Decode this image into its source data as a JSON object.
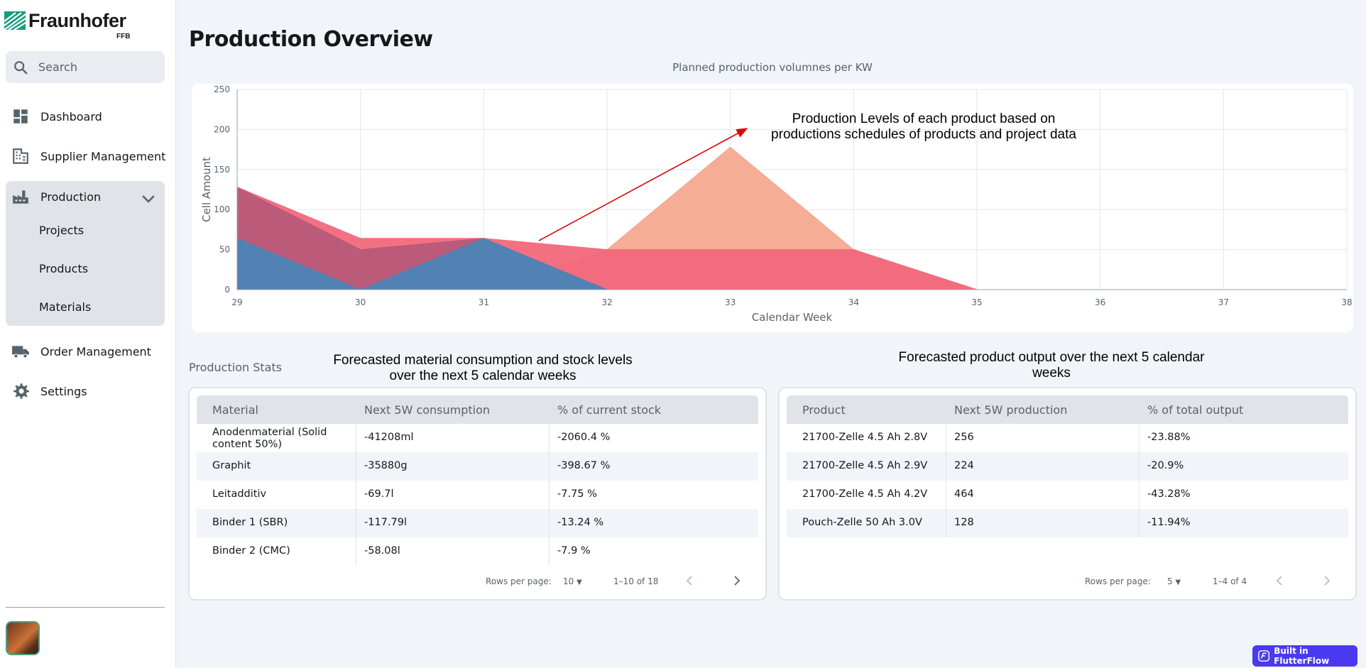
{
  "brand": {
    "name": "Fraunhofer",
    "sub": "FFB"
  },
  "search": {
    "placeholder": "Search"
  },
  "nav": {
    "dashboard": "Dashboard",
    "supplier": "Supplier Management",
    "production": "Production",
    "projects": "Projects",
    "products": "Products",
    "materials": "Materials",
    "order": "Order Management",
    "settings": "Settings"
  },
  "page": {
    "title": "Production Overview"
  },
  "chart_data": {
    "type": "area",
    "title": "Planned production volumnes per KW",
    "xlabel": "Calendar Week",
    "ylabel": "Cell Amount",
    "x": [
      29,
      30,
      31,
      32,
      33,
      34,
      35,
      36,
      37,
      38
    ],
    "ylim": [
      0,
      250
    ],
    "yticks": [
      0,
      50,
      100,
      150,
      200,
      250
    ],
    "grid": true,
    "series": [
      {
        "color": "#f4a98f",
        "values": [
          0,
          0,
          0,
          50,
          178,
          50,
          0,
          0,
          0,
          0
        ]
      },
      {
        "color": "#f2687c",
        "values": [
          128,
          64,
          64,
          50,
          50,
          50,
          0,
          0,
          0,
          0
        ]
      },
      {
        "color": "#b85a78",
        "values": [
          128,
          50,
          64,
          0,
          0,
          0,
          0,
          0,
          0,
          0
        ]
      },
      {
        "color": "#4c84b6",
        "values": [
          64,
          0,
          64,
          0,
          0,
          0,
          0,
          0,
          0,
          0
        ]
      }
    ]
  },
  "annotations": {
    "chart": "Production Levels of each product based on productions schedules of products and project data",
    "materials": "Forecasted material consumption and stock levels over the next 5 calendar weeks",
    "products": "Forecasted product output over the next 5 calendar weeks"
  },
  "stats": {
    "label": "Production Stats"
  },
  "materials_table": {
    "headers": [
      "Material",
      "Next 5W consumption",
      "% of current stock"
    ],
    "rows": [
      [
        "Anodenmaterial (Solid content 50%)",
        "-41208ml",
        "-2060.4 %"
      ],
      [
        "Graphit",
        "-35880g",
        "-398.67 %"
      ],
      [
        "Leitadditiv",
        "-69.7l",
        "-7.75 %"
      ],
      [
        "Binder 1 (SBR)",
        "-117.79l",
        "-13.24 %"
      ],
      [
        "Binder 2 (CMC)",
        "-58.08l",
        "-7.9 %"
      ]
    ],
    "footer": {
      "rows_label": "Rows per page:",
      "rows_value": "10",
      "range": "1–10 of 18"
    }
  },
  "products_table": {
    "headers": [
      "Product",
      "Next 5W production",
      "% of total output"
    ],
    "rows": [
      [
        "21700-Zelle 4.5 Ah 2.8V",
        "256",
        "-23.88%"
      ],
      [
        "21700-Zelle 4.5 Ah 2.9V",
        "224",
        "-20.9%"
      ],
      [
        "21700-Zelle 4.5 Ah 4.2V",
        "464",
        "-43.28%"
      ],
      [
        "Pouch-Zelle 50 Ah 3.0V",
        "128",
        "-11.94%"
      ]
    ],
    "footer": {
      "rows_label": "Rows per page:",
      "rows_value": "5",
      "range": "1–4 of 4"
    }
  },
  "badge": {
    "label": "Built in FlutterFlow"
  }
}
